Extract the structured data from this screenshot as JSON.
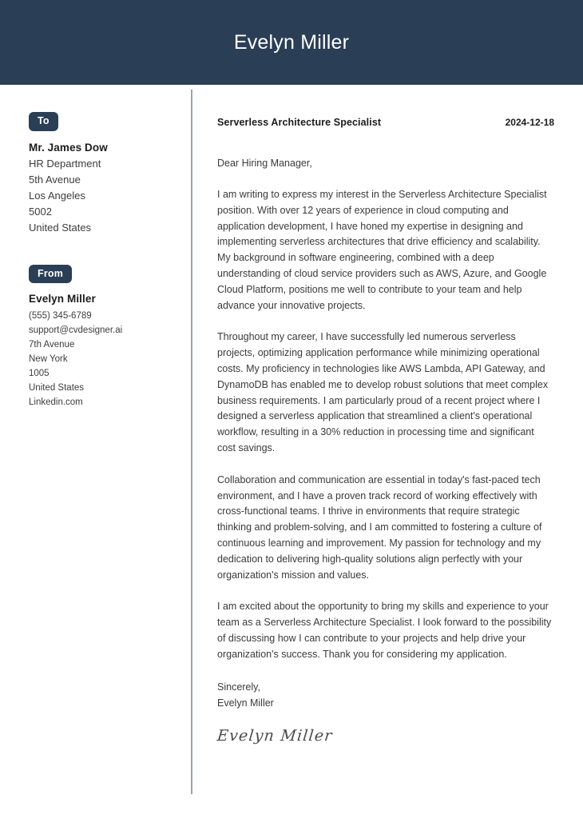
{
  "header": {
    "name": "Evelyn Miller"
  },
  "sidebar": {
    "to": {
      "badge_label": "To",
      "name": "Mr. James Dow",
      "lines": [
        "HR Department",
        "5th Avenue",
        "Los Angeles",
        "5002",
        "United States"
      ]
    },
    "from": {
      "badge_label": "From",
      "name": "Evelyn Miller",
      "lines": [
        "(555) 345-6789",
        "support@cvdesigner.ai",
        "7th Avenue",
        "New York",
        "1005",
        "United States",
        "Linkedin.com"
      ]
    }
  },
  "letter": {
    "title": "Serverless Architecture Specialist",
    "date": "2024-12-18",
    "salutation": "Dear Hiring Manager,",
    "paragraphs": [
      "I am writing to express my interest in the Serverless Architecture Specialist position. With over 12 years of experience in cloud computing and application development, I have honed my expertise in designing and implementing serverless architectures that drive efficiency and scalability. My background in software engineering, combined with a deep understanding of cloud service providers such as AWS, Azure, and Google Cloud Platform, positions me well to contribute to your team and help advance your innovative projects.",
      "Throughout my career, I have successfully led numerous serverless projects, optimizing application performance while minimizing operational costs. My proficiency in technologies like AWS Lambda, API Gateway, and DynamoDB has enabled me to develop robust solutions that meet complex business requirements. I am particularly proud of a recent project where I designed a serverless application that streamlined a client's operational workflow, resulting in a 30% reduction in processing time and significant cost savings.",
      "Collaboration and communication are essential in today's fast-paced tech environment, and I have a proven track record of working effectively with cross-functional teams. I thrive in environments that require strategic thinking and problem-solving, and I am committed to fostering a culture of continuous learning and improvement. My passion for technology and my dedication to delivering high-quality solutions align perfectly with your organization's mission and values.",
      "I am excited about the opportunity to bring my skills and experience to your team as a Serverless Architecture Specialist. I look forward to the possibility of discussing how I can contribute to your projects and help drive your organization's success. Thank you for considering my application."
    ],
    "closing": "Sincerely,",
    "closing_name": "Evelyn Miller",
    "signature": "Evelyn Miller"
  },
  "colors": {
    "banner": "#2a3e55",
    "badge": "#2a3e55",
    "divider": "#97a3b0",
    "body_text": "#3a3a3a"
  }
}
